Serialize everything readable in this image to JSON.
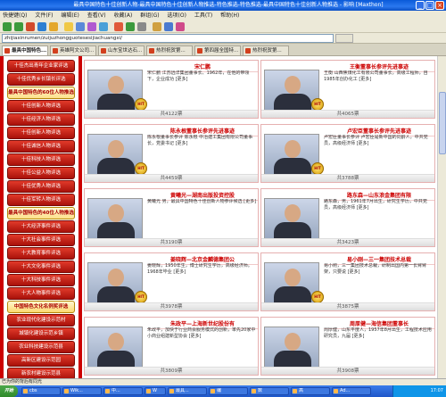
{
  "window": {
    "title": "最具中国特色十佳创新人物-最具中国特色十佳创新人物推选-特色推选-特色推选-最具中国特色十佳创新人物推选 - 影响 [Maxthon]"
  },
  "menubar": {
    "items": [
      "快捷键(Q)",
      "文件(F)",
      "编辑(E)",
      "查看(V)",
      "收藏(A)",
      "群组(G)",
      "选项(O)",
      "工具(T)",
      "帮助(H)"
    ]
  },
  "address": {
    "value": "zhijiaxinrumen/zuijuzhongguotesesijiachuangxi/"
  },
  "tabs": [
    "最具中国特色...",
    "英雄阿文公司...",
    "山东宝世达石...",
    "热烈祝贺第...",
    "第四届全国特...",
    "热烈祝贺第..."
  ],
  "sidebar": {
    "items": [
      {
        "label": "十佳杰出青年企业家评选",
        "style": "red"
      },
      {
        "label": "十佳优秀乡长镇长评选",
        "style": "red"
      },
      {
        "label": "最具中国特色的60位人物推选",
        "style": "hd"
      },
      {
        "label": "十佳创新人物评选",
        "style": "red"
      },
      {
        "label": "十佳经济人物评选",
        "style": "red"
      },
      {
        "label": "十佳创新人物评选",
        "style": "red"
      },
      {
        "label": "十佳诚信人物评选",
        "style": "red"
      },
      {
        "label": "十佳科技人物评选",
        "style": "red"
      },
      {
        "label": "十佳公益人物评选",
        "style": "red"
      },
      {
        "label": "十佳优秀人物评选",
        "style": "red"
      },
      {
        "label": "十佳军转人物评选",
        "style": "red"
      },
      {
        "label": "最具中国特色的40位人物推选",
        "style": "hd"
      },
      {
        "label": "十大经济事件评选",
        "style": "red"
      },
      {
        "label": "十大社会事件评选",
        "style": "red"
      },
      {
        "label": "十大教育事件评选",
        "style": "red"
      },
      {
        "label": "十大文化事件评选",
        "style": "red"
      },
      {
        "label": "十大科技事件评选",
        "style": "red"
      },
      {
        "label": "十大人物事件评选",
        "style": "red"
      },
      {
        "label": "中国特色文化名例奖评选",
        "style": "gd"
      },
      {
        "label": "农业现代化建设示范村",
        "style": "red"
      },
      {
        "label": "城镇化建设示范乡镇",
        "style": "red"
      },
      {
        "label": "农业科技建设示范县",
        "style": "red"
      },
      {
        "label": "高新区建设示范园",
        "style": "red"
      },
      {
        "label": "新农村建设示范县",
        "style": "red"
      }
    ]
  },
  "cards": [
    {
      "name": "宋仁鹏",
      "desc": "宋仁鹏 江苏远洋集团董事长、1962年，在他的带领下，企业成功 [更多]",
      "count": "共4122票"
    },
    {
      "name": "王衡董事长参评先进事迹",
      "desc": "王衡 山西焦煤化工有限公司董事长，高级工程师，自1985年创办化工 [更多]",
      "count": "共4065票"
    },
    {
      "name": "陈永根董事长参评先进事迹",
      "desc": "陈永根董事长参评 陈永根 中冶建工集团有限公司董事长，党委书记 [更多]",
      "count": "共4459票"
    },
    {
      "name": "卢宏臣董事长参评先进事迹",
      "desc": "卢宏臣董事长参评 卢宏臣是新中国的同龄人，中共党员，高级经济师 [更多]",
      "count": "共3788票"
    },
    {
      "name": "黄曦光—湖南出版投资控股",
      "desc": "黄曦光 男，最具中国特色十佳创新人物参评候选 [更多]",
      "count": "共3190票"
    },
    {
      "name": "路东森—山东浪金集团有限",
      "desc": "路东森，男，1961年7月出生，研究生学历，中共党员，高级经济师 [更多]",
      "count": "共3423票"
    },
    {
      "name": "姜晓辉—北京金麟德集团公",
      "desc": "姜晓辉，1950年生，博士研究生学历，高级经济师。1968年毕业 [更多]",
      "count": "共3978票"
    },
    {
      "name": "易小刚—三一集团技术总裁",
      "desc": "易小刚，三一集团技术总裁，研制出国内第一长臂臂架，只要说 [更多]",
      "count": "共3875票"
    },
    {
      "name": "朱政平—上海新世纪股份有",
      "desc": "朱政平，加快于行业商会服务模式的创新，率先20家中小商业组建新型协会 [更多]",
      "count": "共3809票"
    },
    {
      "name": "周厚健—海信集团董事长",
      "desc": "周厚健，山东平度人，1957年8月出生，工程技术应用研究员，九届 [更多]",
      "count": "共3908票"
    }
  ],
  "status": {
    "text": "已为你的背后有同光"
  },
  "taskbar": {
    "start": "开始",
    "tasks": [
      "cbs",
      "Wik...",
      "中...",
      "W",
      "最具...",
      "编",
      "数",
      "高",
      "Ad..."
    ],
    "clock": "17:07"
  }
}
